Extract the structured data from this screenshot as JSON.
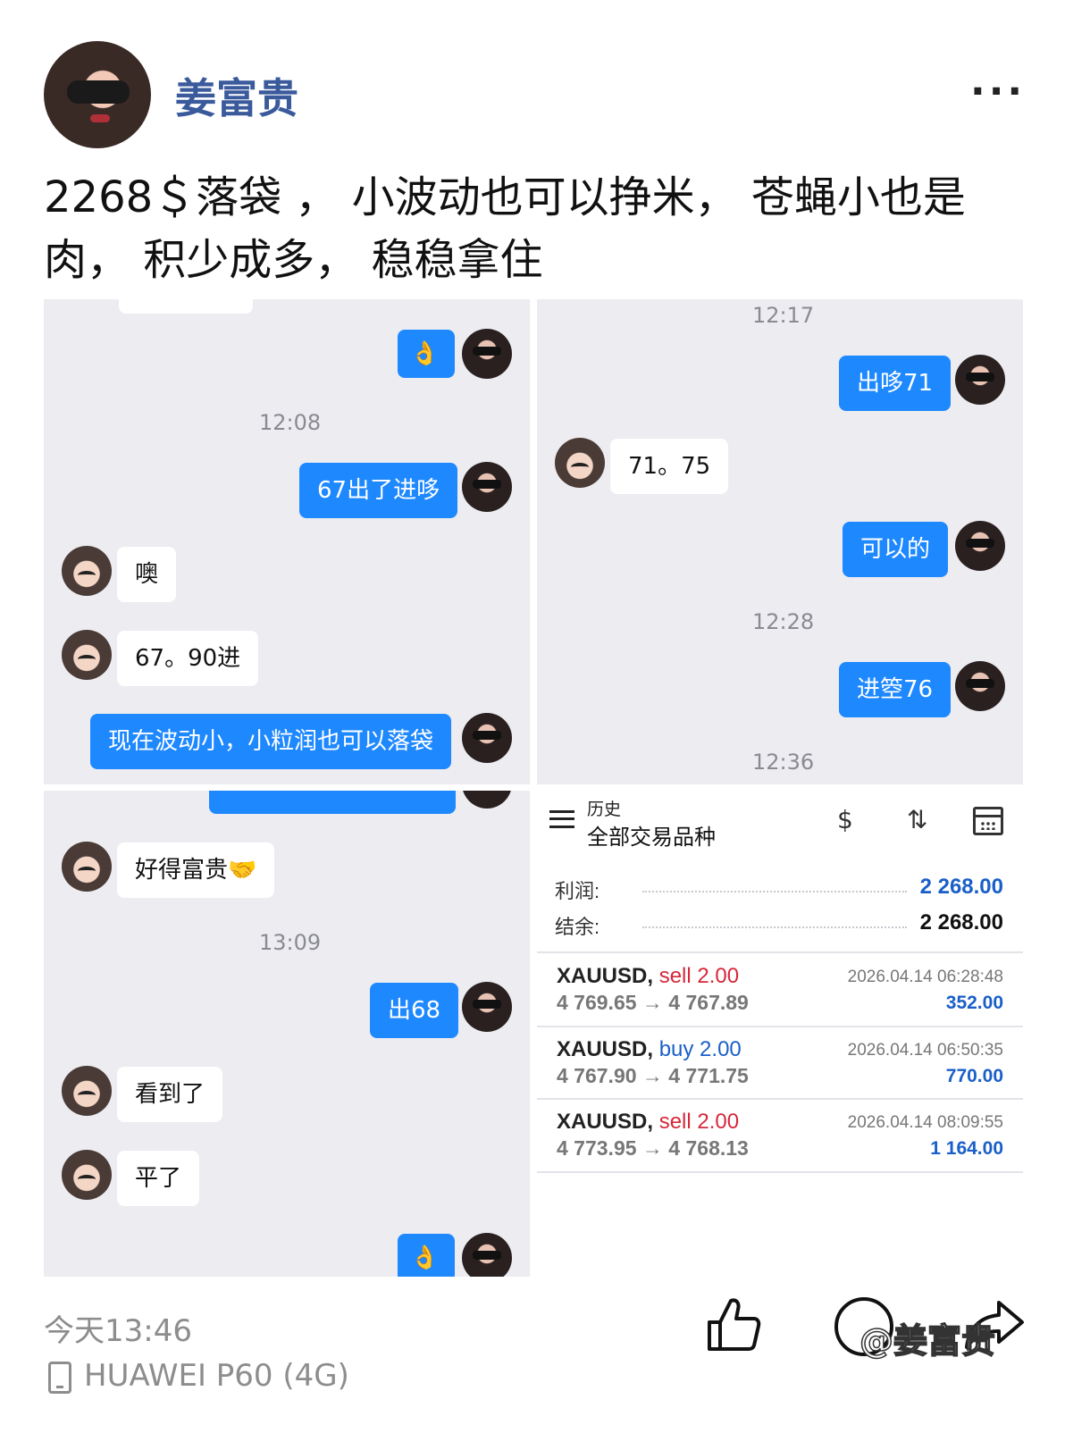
{
  "author": {
    "name": "姜富贵"
  },
  "post": {
    "text": "2268＄落袋 ， 小波动也可以挣米， 苍蝇小也是肉， 积少成多， 稳稳拿住"
  },
  "chat1": {
    "msgs": [
      {
        "from": "me",
        "text": "👌"
      },
      {
        "time": "12:08"
      },
      {
        "from": "me",
        "text": "67出了进哆"
      },
      {
        "from": "other",
        "text": "噢"
      },
      {
        "from": "other",
        "text": "67。90进"
      },
      {
        "from": "me",
        "text": "现在波动小，小粒润也可以落袋"
      }
    ]
  },
  "chat2": {
    "time1": "12:17",
    "m1": "出哆71",
    "m2": "71。75",
    "m3": "可以的",
    "time2": "12:28",
    "m4": "进箜76",
    "time3": "12:36"
  },
  "chat3": {
    "m1": "好得富贵🤝",
    "time1": "13:09",
    "m2": "出68",
    "m3": "看到了",
    "m4": "平了",
    "m5": "👌"
  },
  "trade": {
    "header_small": "历史",
    "header_title": "全部交易品种",
    "profit_label": "利润:",
    "profit_value": "2 268.00",
    "balance_label": "结余:",
    "balance_value": "2 268.00",
    "rows": [
      {
        "symbol": "XAUUSD,",
        "side": "sell 2.00",
        "prices": "4 769.65 → 4 767.89",
        "date": "2026.04.14 06:28:48",
        "profit": "352.00"
      },
      {
        "symbol": "XAUUSD,",
        "side": "buy 2.00",
        "prices": "4 767.90 → 4 771.75",
        "date": "2026.04.14 06:50:35",
        "profit": "770.00"
      },
      {
        "symbol": "XAUUSD,",
        "side": "sell 2.00",
        "prices": "4 773.95 → 4 768.13",
        "date": "2026.04.14 08:09:55",
        "profit": "1 164.00"
      }
    ],
    "colors": {
      "sell": "#d6283a",
      "buy": "#1a5fc8",
      "profit": "#1a5fc8"
    }
  },
  "footer": {
    "time": "今天13:46",
    "device": "HUAWEI P60 (4G)",
    "watermark": "@姜富贵"
  },
  "icons": [
    "more-icon",
    "menu-icon",
    "currency-icon",
    "sort-icon",
    "calendar-icon",
    "phone-icon",
    "like-icon",
    "comment-icon",
    "share-icon"
  ]
}
